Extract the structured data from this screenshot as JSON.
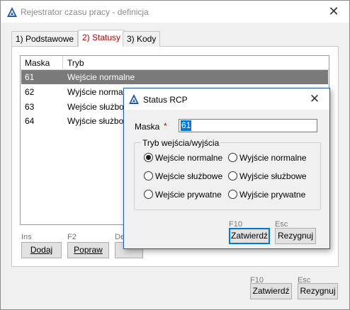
{
  "window": {
    "title": "Rejestrator czasu pracy - definicja"
  },
  "tabs": [
    {
      "label": "1) Podstawowe"
    },
    {
      "label": "2) Statusy"
    },
    {
      "label": "3) Kody"
    }
  ],
  "grid": {
    "columns": [
      "Maska",
      "Tryb"
    ],
    "rows": [
      {
        "maska": "61",
        "tryb": "Wejście normalne"
      },
      {
        "maska": "62",
        "tryb": "Wyjście normalne"
      },
      {
        "maska": "63",
        "tryb": "Wejście służbowe"
      },
      {
        "maska": "64",
        "tryb": "Wyjście służbowe"
      }
    ]
  },
  "grid_buttons": {
    "add": {
      "hotkey": "Ins",
      "label": "Dodaj"
    },
    "edit": {
      "hotkey": "F2",
      "label": "Popraw"
    },
    "delete": {
      "hotkey": "De",
      "label": ""
    }
  },
  "main_buttons": {
    "ok": {
      "hotkey": "F10",
      "label": "Zatwierdź"
    },
    "cancel": {
      "hotkey": "Esc",
      "label": "Rezygnuj"
    }
  },
  "dialog": {
    "title": "Status RCP",
    "maska_label": "Maska",
    "required_mark": "*",
    "maska_value": "61",
    "group_label": "Tryb wejścia/wyjścia",
    "options": [
      "Wejście normalne",
      "Wyjście normalne",
      "Wejście służbowe",
      "Wyjście służbowe",
      "Wejście prywatne",
      "Wyjście prywatne"
    ],
    "selected_option": "Wejście normalne",
    "ok": {
      "hotkey": "F10",
      "label": "Zatwierdź"
    },
    "cancel": {
      "hotkey": "Esc",
      "label": "Rezygnuj"
    }
  },
  "colors": {
    "accent": "#1e5aa8",
    "active_tab_text": "#b00000",
    "selected_row": "#7a7a7a",
    "required_mark": "#c00000"
  }
}
